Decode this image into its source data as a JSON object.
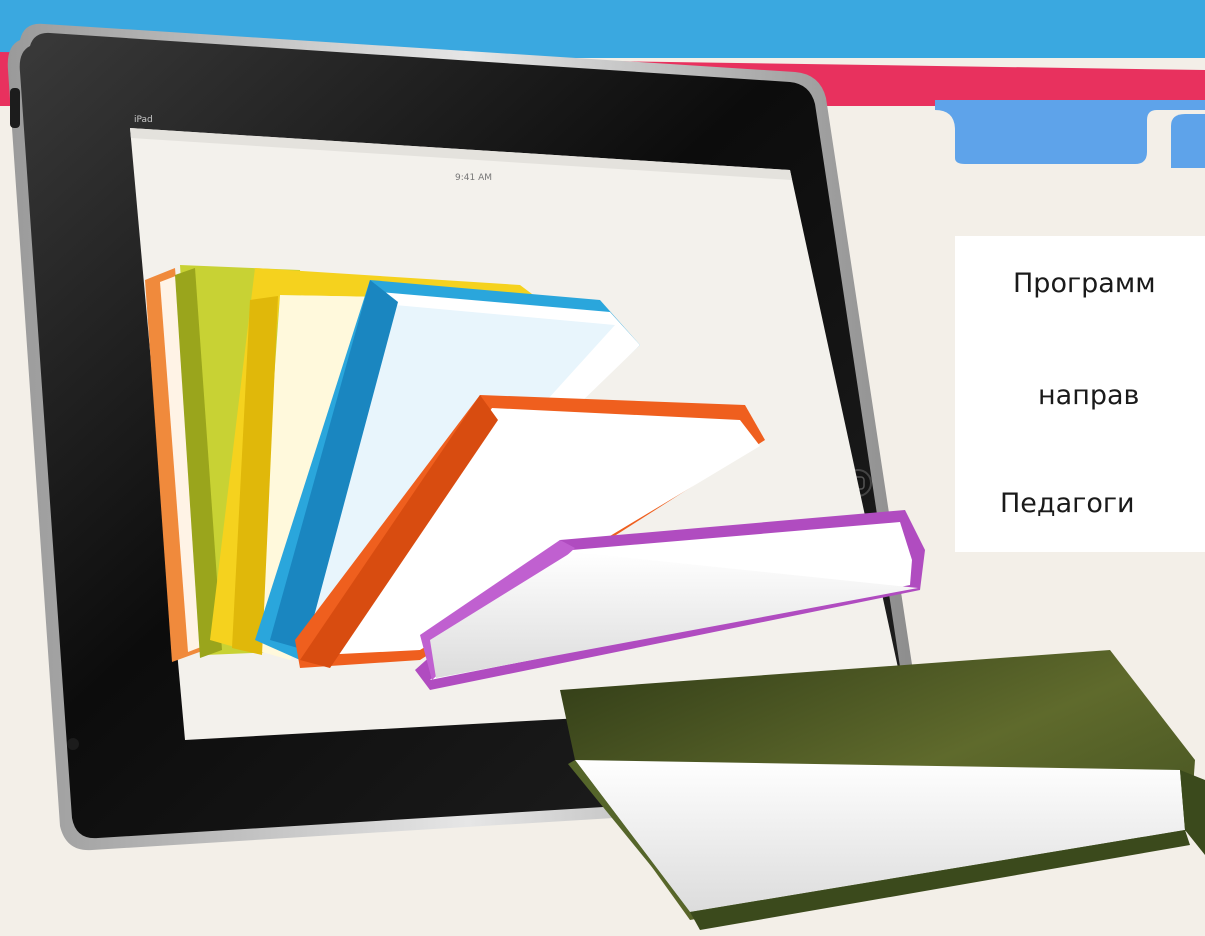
{
  "colors": {
    "background": "#f3efe8",
    "top_band": "#3aa8e0",
    "pink_band": "#e8315e",
    "tab_blue": "#5ea3ea",
    "text": "#1a1a1a",
    "panel": "#ffffff"
  },
  "tablet": {
    "status_left": "iPad",
    "status_time": "9:41 AM"
  },
  "text_panel": {
    "lines": [
      "Программ",
      "направ",
      "Педагоги"
    ]
  },
  "books": [
    {
      "color": "#f08a3c"
    },
    {
      "color": "#c8d234"
    },
    {
      "color": "#f5d21e"
    },
    {
      "color": "#2aa6dc"
    },
    {
      "color": "#ef5f1e"
    },
    {
      "color": "#b04cc0"
    },
    {
      "color": "#4a5a24"
    }
  ]
}
